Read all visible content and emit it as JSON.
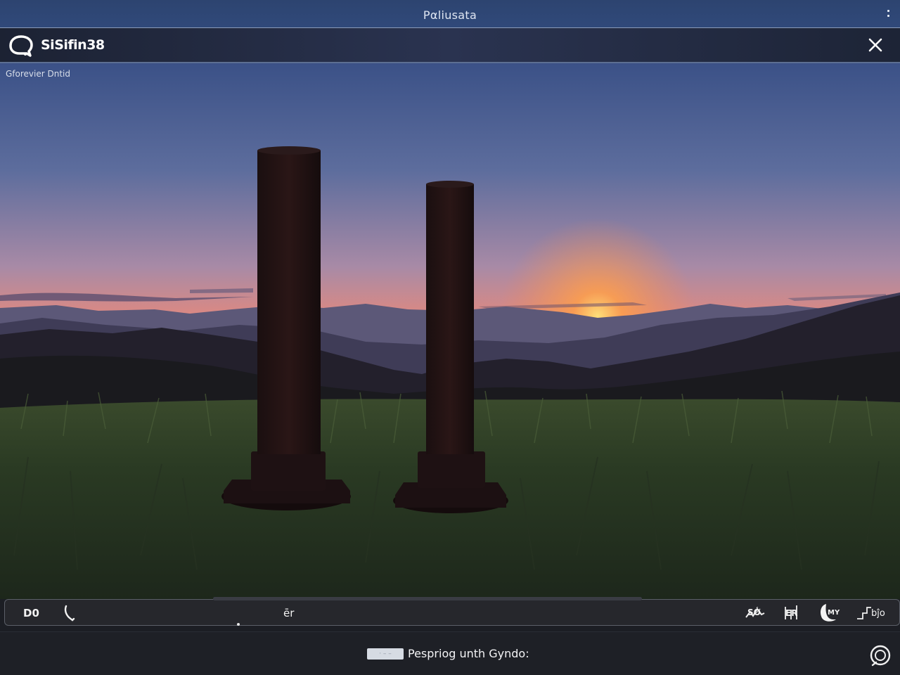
{
  "window": {
    "title": "Pαliusata"
  },
  "header": {
    "app_name": "SiSifin38",
    "logo_icon": "chat-bubble-icon",
    "close_icon": "close-icon"
  },
  "scene": {
    "caption": "Gforevier Dntid",
    "colors": {
      "sky_top": "#3b5187",
      "sky_mid": "#8a86a8",
      "horizon": "#f4915f",
      "sun": "#ffcf63",
      "grass": "#2a3a23"
    }
  },
  "controls": {
    "left_label": "D0",
    "left_icon": "phone-icon",
    "center_label": "ēr",
    "right_buttons": [
      {
        "label": "SǾ",
        "icon": "waveform-icon"
      },
      {
        "label": "ER",
        "icon": "equalizer-icon"
      },
      {
        "label": "MY",
        "icon": "moon-icon"
      },
      {
        "label": "bĵo",
        "icon": "stairs-icon"
      }
    ]
  },
  "status": {
    "badge": "· – –",
    "text": "Pespriog unth Gyndo:",
    "icon": "refresh-icon"
  }
}
